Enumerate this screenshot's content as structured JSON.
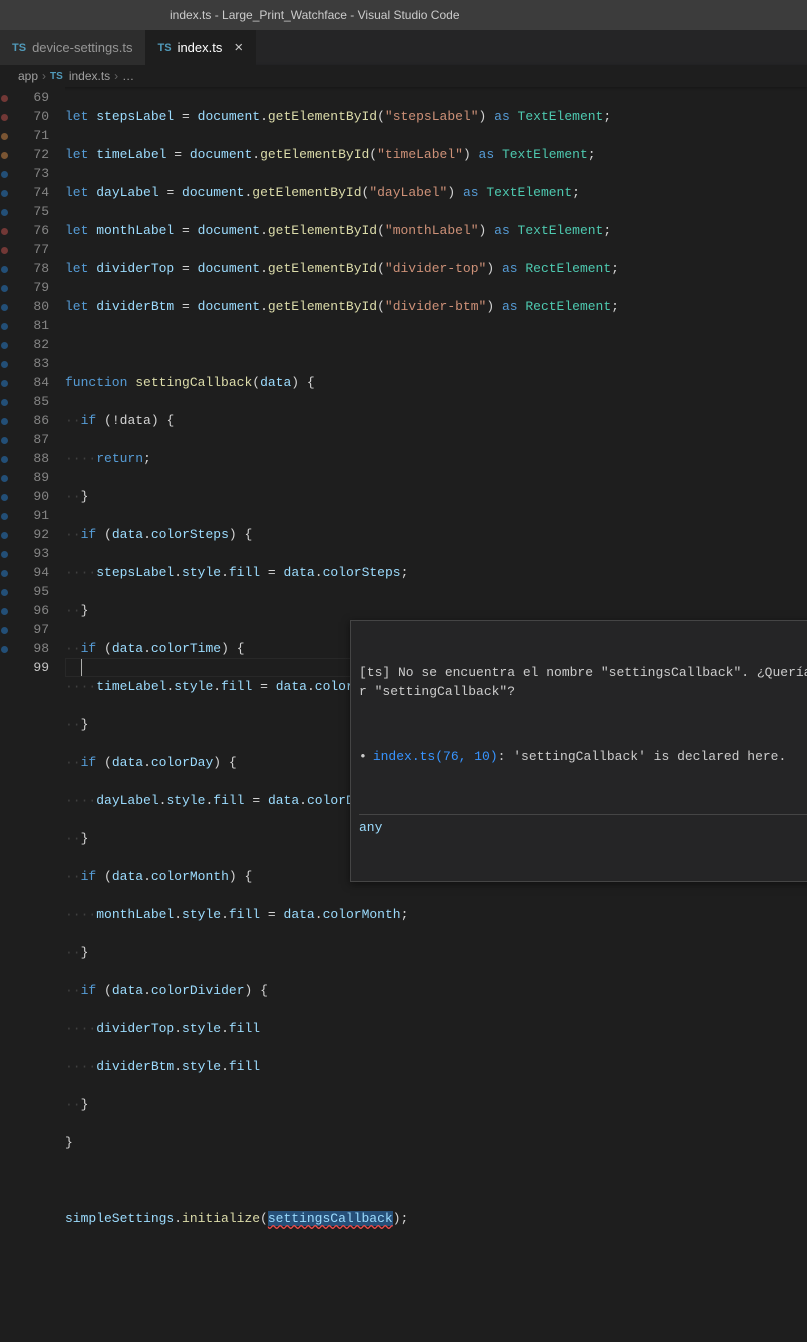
{
  "title": "index.ts - Large_Print_Watchface - Visual Studio Code",
  "tabs": [
    {
      "icon": "TS",
      "label": "device-settings.ts",
      "active": false
    },
    {
      "icon": "TS",
      "label": "index.ts",
      "active": true
    }
  ],
  "breadcrumb": {
    "seg1": "app",
    "seg2_icon": "TS",
    "seg2": "index.ts",
    "more": "…"
  },
  "lines": {
    "start": 69,
    "end": 99,
    "current": 99
  },
  "code": {
    "l69": {
      "kw": "let",
      "var": "stepsLabel",
      "eq": " = ",
      "obj": "document",
      "dot": ".",
      "fn": "getElementById",
      "lp": "(",
      "str": "\"stepsLabel\"",
      "rp": ") ",
      "as": "as ",
      "type": "TextElement",
      "sc": ";"
    },
    "l70": {
      "kw": "let",
      "var": "timeLabel",
      "eq": " = ",
      "obj": "document",
      "dot": ".",
      "fn": "getElementById",
      "lp": "(",
      "str": "\"timeLabel\"",
      "rp": ") ",
      "as": "as ",
      "type": "TextElement",
      "sc": ";"
    },
    "l71": {
      "kw": "let",
      "var": "dayLabel",
      "eq": " = ",
      "obj": "document",
      "dot": ".",
      "fn": "getElementById",
      "lp": "(",
      "str": "\"dayLabel\"",
      "rp": ") ",
      "as": "as ",
      "type": "TextElement",
      "sc": ";"
    },
    "l72": {
      "kw": "let",
      "var": "monthLabel",
      "eq": " = ",
      "obj": "document",
      "dot": ".",
      "fn": "getElementById",
      "lp": "(",
      "str": "\"monthLabel\"",
      "rp": ") ",
      "as": "as ",
      "type": "TextElement",
      "sc": ";"
    },
    "l73": {
      "kw": "let",
      "var": "dividerTop",
      "eq": " = ",
      "obj": "document",
      "dot": ".",
      "fn": "getElementById",
      "lp": "(",
      "str": "\"divider-top\"",
      "rp": ") ",
      "as": "as ",
      "type": "RectElement",
      "sc": ";"
    },
    "l74": {
      "kw": "let",
      "var": "dividerBtm",
      "eq": " = ",
      "obj": "document",
      "dot": ".",
      "fn": "getElementById",
      "lp": "(",
      "str": "\"divider-btm\"",
      "rp": ") ",
      "as": "as ",
      "type": "RectElement",
      "sc": ";"
    },
    "l76": {
      "kw": "function",
      "name": "settingCallback",
      "params": "data"
    },
    "l77": {
      "kw": "if",
      "cond": "!data"
    },
    "l78": {
      "kw": "return",
      "sc": ";"
    },
    "l80": {
      "kw": "if",
      "obj": "data",
      "prop": "colorSteps"
    },
    "l81": {
      "obj": "stepsLabel",
      "p1": "style",
      "p2": "fill",
      "rhs_obj": "data",
      "rhs_prop": "colorSteps"
    },
    "l83": {
      "kw": "if",
      "obj": "data",
      "prop": "colorTime"
    },
    "l84": {
      "obj": "timeLabel",
      "p1": "style",
      "p2": "fill",
      "rhs_obj": "data",
      "rhs_prop": "colorTime"
    },
    "l86": {
      "kw": "if",
      "obj": "data",
      "prop": "colorDay"
    },
    "l87": {
      "obj": "dayLabel",
      "p1": "style",
      "p2": "fill",
      "rhs_obj": "data",
      "rhs_prop": "colorDay"
    },
    "l89": {
      "kw": "if",
      "obj": "data",
      "prop": "colorMonth"
    },
    "l90": {
      "obj": "monthLabel",
      "p1": "style",
      "p2": "fill",
      "rhs_obj": "data",
      "rhs_prop": "colorMonth"
    },
    "l92": {
      "kw": "if",
      "obj": "data",
      "prop": "colorDivider"
    },
    "l93": {
      "obj": "dividerTop",
      "p1": "style",
      "p2": "fill"
    },
    "l94": {
      "obj": "dividerBtm",
      "p1": "style",
      "p2": "fill"
    },
    "l98": {
      "obj": "simpleSettings",
      "fn": "initialize",
      "arg": "settingsCallback"
    }
  },
  "hover": {
    "msg1": "[ts] No se encuentra el nombre \"settingsCallback\". ¿Quería deci",
    "msg2": "r \"settingCallback\"?",
    "link": "index.ts(76, 10)",
    "decl": ": 'settingCallback' is declared here.",
    "type": "any"
  },
  "activity_dots": [
    "#723836",
    "#723836",
    "#7a5533",
    "#7a5533",
    "#234f77",
    "#234f77",
    "#234f77",
    "#723836",
    "#723836",
    "#234f77",
    "#234f77",
    "#234f77",
    "#234f77",
    "#234f77",
    "#234f77",
    "#234f77",
    "#234f77",
    "#234f77",
    "#234f77",
    "#234f77",
    "#234f77",
    "#234f77",
    "#234f77",
    "#234f77",
    "#234f77",
    "#234f77",
    "#234f77",
    "#234f77",
    "#234f77",
    "#234f77"
  ]
}
